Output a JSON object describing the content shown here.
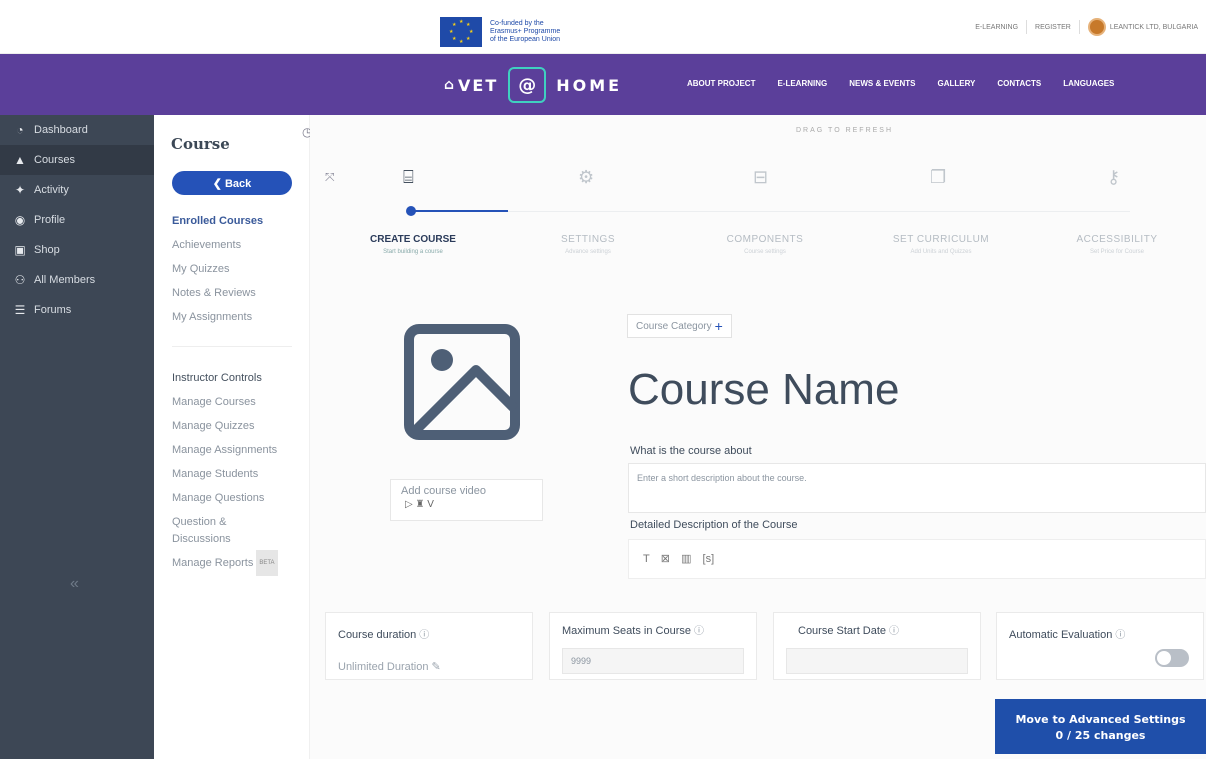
{
  "topbar": {
    "eu_text": [
      "Co-funded by the",
      "Erasmus+ Programme",
      "of the European Union"
    ],
    "links": [
      "E-LEARNING",
      "REGISTER"
    ],
    "user": "LEANTICK LTD, BULGARIA"
  },
  "nav": {
    "logo_vet": "VET",
    "logo_at": "@",
    "logo_home": "HOME",
    "links": [
      "ABOUT PROJECT",
      "E-LEARNING",
      "NEWS & EVENTS",
      "GALLERY",
      "CONTACTS",
      "LANGUAGES"
    ]
  },
  "sidebar": {
    "items": [
      {
        "label": "Dashboard",
        "icon": "dashboard-icon",
        "glyph": "◔"
      },
      {
        "label": "Courses",
        "icon": "graduation-cap-icon",
        "glyph": "🎓"
      },
      {
        "label": "Activity",
        "icon": "activity-icon",
        "glyph": "✦"
      },
      {
        "label": "Profile",
        "icon": "profile-icon",
        "glyph": "◉"
      },
      {
        "label": "Shop",
        "icon": "shopping-bag-icon",
        "glyph": "▣"
      },
      {
        "label": "All Members",
        "icon": "members-icon",
        "glyph": "⚇"
      },
      {
        "label": "Forums",
        "icon": "forums-icon",
        "glyph": "☰"
      }
    ],
    "active_index": 1,
    "collapse_glyph": "«"
  },
  "course_menu": {
    "title": "Course",
    "back_label": "❮ Back",
    "enrolled_head": "Enrolled Courses",
    "enrolled_items": [
      "Achievements",
      "My Quizzes",
      "Notes & Reviews",
      "My Assignments"
    ],
    "instructor_head": "Instructor Controls",
    "instructor_items": [
      "Manage Courses",
      "Manage Quizzes",
      "Manage Assignments",
      "Manage Students",
      "Manage Questions",
      "Question &",
      "Discussions"
    ],
    "reports_label": "Manage Reports",
    "beta_label": "BETA"
  },
  "main": {
    "refresh_text": "DRAG TO REFRESH",
    "steps": [
      {
        "label": "CREATE COURSE",
        "sub": "Start building a course",
        "icon": "course-builder-icon",
        "glyph": "⌸"
      },
      {
        "label": "SETTINGS",
        "sub": "Advance settings",
        "icon": "settings-gear-icon",
        "glyph": "⚙"
      },
      {
        "label": "COMPONENTS",
        "sub": "Course settings",
        "icon": "components-briefcase-icon",
        "glyph": "⊟"
      },
      {
        "label": "SET CURRICULUM",
        "sub": "Add Units and Quizzes",
        "icon": "curriculum-icon",
        "glyph": "❐"
      },
      {
        "label": "ACCESSIBILITY",
        "sub": "Set Price for Course",
        "icon": "key-icon",
        "glyph": "⚷"
      }
    ],
    "category_label": "Course Category",
    "course_name": "Course Name",
    "about_label": "What is the course about",
    "about_placeholder": "Enter a short description about the course.",
    "video_label": "Add course video",
    "video_icons": "▷ ♜ V",
    "detailed_label": "Detailed Description of the Course",
    "editor_tools": [
      "T",
      "⊠",
      "▥",
      "[s]"
    ],
    "duration": {
      "title": "Course duration",
      "value": "Unlimited Duration ✎"
    },
    "seats": {
      "title": "Maximum Seats in Course",
      "value": "9999"
    },
    "start_date": {
      "title": "Course Start Date",
      "value": ""
    },
    "auto_eval": {
      "title": "Automatic Evaluation",
      "enabled": false
    },
    "help_glyph": "ⓘ",
    "advanced_button": {
      "line1": "Move to Advanced Settings",
      "line2": "0 / 25 changes"
    }
  },
  "colors": {
    "nav": "#5b3f9a",
    "sidebar": "#3d4755",
    "accent": "#2552b8"
  }
}
